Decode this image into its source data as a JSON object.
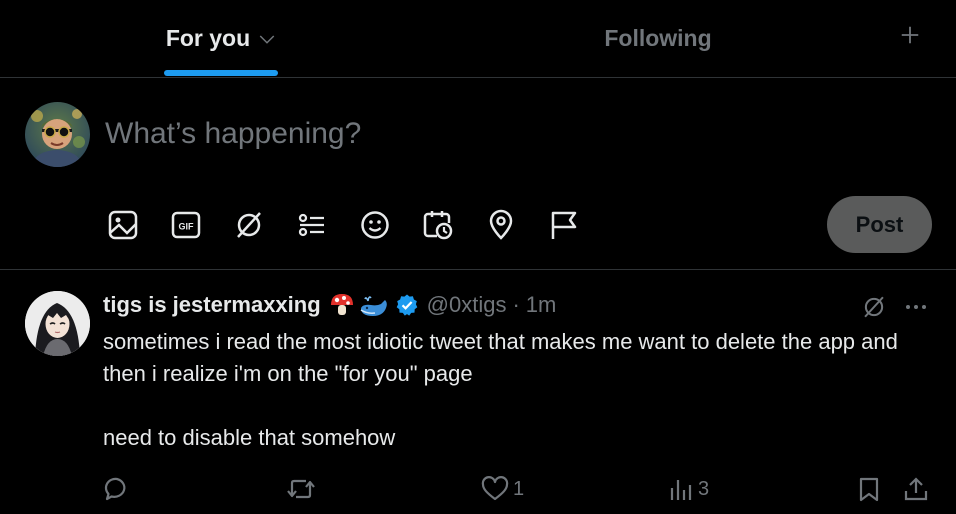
{
  "tabs": {
    "for_you": "For you",
    "following": "Following"
  },
  "composer": {
    "placeholder": "What’s happening?",
    "post_label": "Post",
    "tools": [
      "image-icon",
      "gif-icon",
      "grok-icon",
      "poll-icon",
      "emoji-icon",
      "schedule-icon",
      "location-icon",
      "flag-icon"
    ]
  },
  "tweet": {
    "display_name": "tigs is jestermaxxing",
    "emojis": [
      "mushroom-icon",
      "whale-icon"
    ],
    "handle": "@0xtigs",
    "separator": "·",
    "time": "1m",
    "text": "sometimes i read the most idiotic tweet that makes me want to delete the app and then i realize i'm on the \"for you\" page\n\nneed to disable that somehow",
    "likes": "1",
    "views": "3"
  },
  "colors": {
    "background": "#000000",
    "accent": "#1d9bf0",
    "text": "#e7e9ea",
    "muted": "#71767b",
    "border": "#2f3336",
    "verified": "#1d9bf0"
  }
}
